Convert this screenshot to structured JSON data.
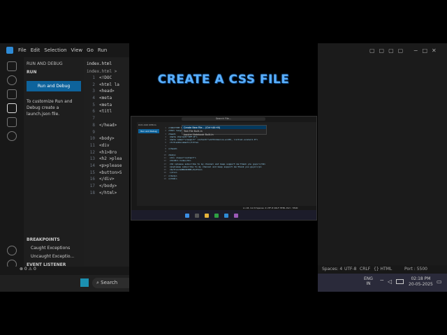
{
  "title_overlay": "CREATE A CSS FILE",
  "left": {
    "menu": [
      "File",
      "Edit",
      "Selection",
      "View",
      "Go",
      "Run"
    ],
    "panel_title": "RUN AND DEBUG",
    "section": "RUN",
    "run_button": "Run and Debug",
    "hint": "To customize Run and Debug create a launch.json file.",
    "tab": "index.html",
    "breadcrumb": "index.html >",
    "lines": [
      {
        "n": "1",
        "t": "<!DOC"
      },
      {
        "n": "2",
        "t": "<html la"
      },
      {
        "n": "3",
        "t": "<head>"
      },
      {
        "n": "4",
        "t": "<meta"
      },
      {
        "n": "5",
        "t": "<meta"
      },
      {
        "n": "6",
        "t": "<titl"
      },
      {
        "n": "7",
        "t": ""
      },
      {
        "n": "8",
        "t": "</head>"
      },
      {
        "n": "9",
        "t": ""
      },
      {
        "n": "10",
        "t": "<body>"
      },
      {
        "n": "11",
        "t": "<div"
      },
      {
        "n": "12",
        "t": "<h1>Bro"
      },
      {
        "n": "13",
        "t": "<h2 >plea"
      },
      {
        "n": "14",
        "t": "<p>please"
      },
      {
        "n": "15",
        "t": "<button>S"
      },
      {
        "n": "16",
        "t": "</div>"
      },
      {
        "n": "17",
        "t": "</body>"
      },
      {
        "n": "18",
        "t": "</html>"
      }
    ],
    "breakpoints": "BREAKPOINTS",
    "bp_items": [
      "Caught Exceptions",
      "Uncaught Exceptio..."
    ],
    "event_listener": "EVENT LISTENER BREAKPOI...",
    "status": "⊗ 0 ⚠ 0",
    "search": "Search"
  },
  "right": {
    "status": [
      "Spaces: 4",
      "UTF-8",
      "CRLF",
      "{} HTML",
      "Port : 5500"
    ],
    "tray": [
      "ENG",
      "IN"
    ],
    "time": "02:18 PM",
    "date": "20-05-2025"
  },
  "center": {
    "command": "Search File...",
    "dropdown": [
      "Create New File... (Ctrl+Alt+N)",
      "Text File  Built-In",
      "Jupyter Notebook  Built-In"
    ],
    "side_title": "RUN AND DEBUG",
    "run_button": "Run and Debug",
    "lines": [
      {
        "n": "1",
        "t": "<!DOCTYPE html>"
      },
      {
        "n": "2",
        "t": "<html lang=\"en\">"
      },
      {
        "n": "3",
        "t": "<head>"
      },
      {
        "n": "4",
        "t": "  <meta charset=\"UTF-8\">"
      },
      {
        "n": "5",
        "t": "  <meta name=\"viewport\" content=\"width=device-width, initial-scale=1.0\">"
      },
      {
        "n": "6",
        "t": "  <title>Document</title>"
      },
      {
        "n": "7",
        "t": ""
      },
      {
        "n": "8",
        "t": "</head>"
      },
      {
        "n": "9",
        "t": ""
      },
      {
        "n": "10",
        "t": "<body>"
      },
      {
        "n": "11",
        "t": "  <div class=\"content\">"
      },
      {
        "n": "12",
        "t": "  <h1>Bro Code</h1>"
      },
      {
        "n": "13",
        "t": "  <h2 >please subscribe to my channel and keep support me:thank you guys!</h2>"
      },
      {
        "n": "14",
        "t": "  <p>please subscribe to my channel and keep support me:thank you guys!</p>"
      },
      {
        "n": "15",
        "t": "  <button>SUBSCRIBE</button>"
      },
      {
        "n": "16",
        "t": "  </div>"
      },
      {
        "n": "17",
        "t": "</body>"
      },
      {
        "n": "18",
        "t": "</html>"
      }
    ],
    "status": "Ln 18, Col 8   Spaces: 4   UTF-8   CRLF   HTML   Port : 5500"
  }
}
